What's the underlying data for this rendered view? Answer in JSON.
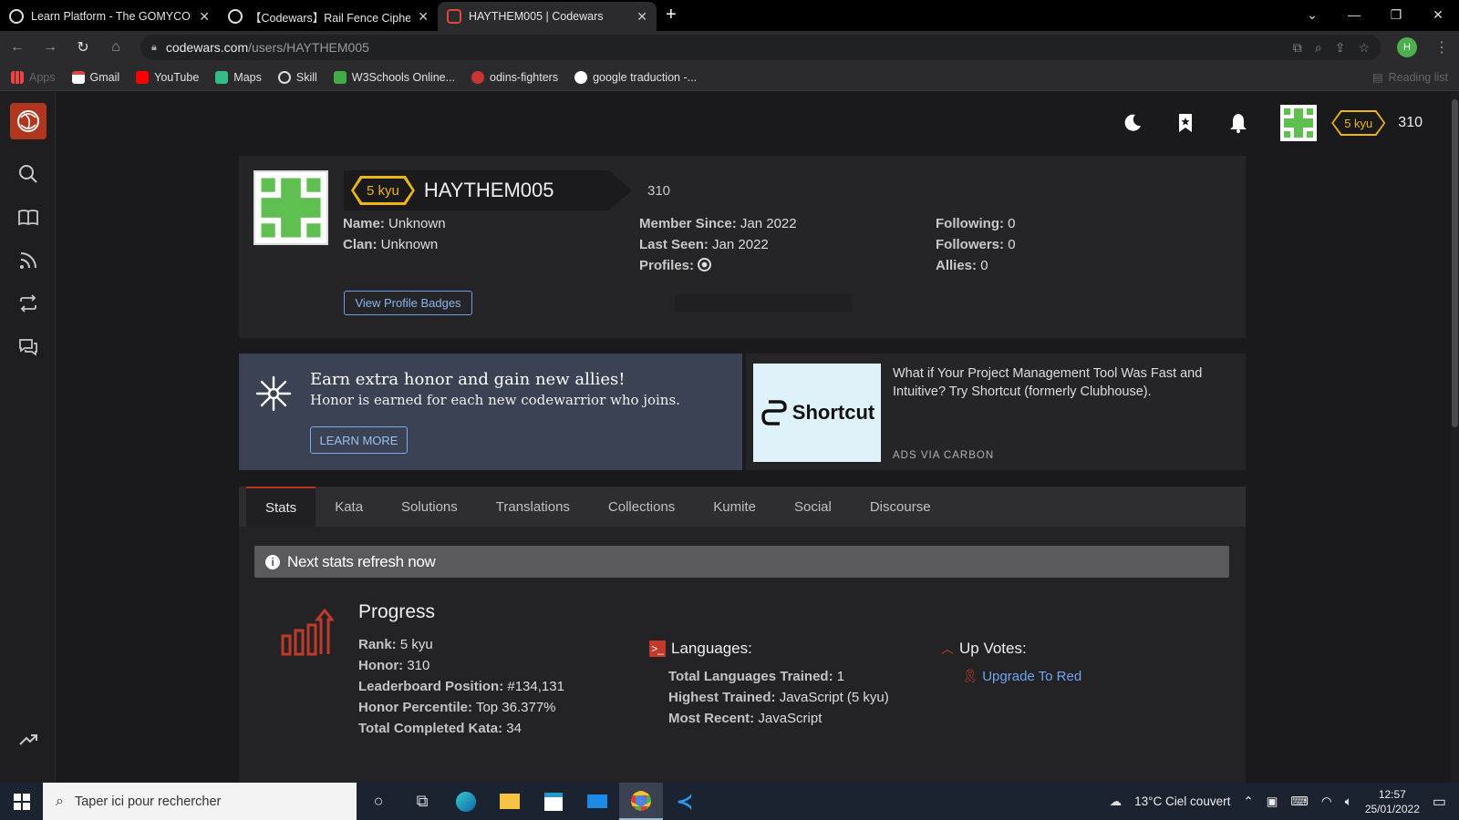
{
  "browser": {
    "tabs": [
      {
        "title": "Learn Platform - The GOMYCODE",
        "close": "✕",
        "favicon": "globe-icon"
      },
      {
        "title": "【Codewars】Rail Fence Cipher: En",
        "close": "✕",
        "favicon": "globe-icon"
      },
      {
        "title": "HAYTHEM005 | Codewars",
        "close": "✕",
        "favicon": "codewars-icon"
      }
    ],
    "new_tab": "+",
    "url_domain": "codewars.com",
    "url_path": "/users/HAYTHEM005",
    "profile_initial": "H",
    "bookmarks": [
      {
        "label": "Apps"
      },
      {
        "label": "Gmail"
      },
      {
        "label": "YouTube"
      },
      {
        "label": "Maps"
      },
      {
        "label": "Skill"
      },
      {
        "label": "W3Schools Online..."
      },
      {
        "label": "odins-fighters"
      },
      {
        "label": "google traduction -..."
      }
    ],
    "reading_list": "Reading list"
  },
  "header": {
    "rank": "5 kyu",
    "honor": "310"
  },
  "profile": {
    "rank": "5 kyu",
    "username": "HAYTHEM005",
    "honor": "310",
    "name_label": "Name:",
    "name_value": "Unknown",
    "clan_label": "Clan:",
    "clan_value": "Unknown",
    "member_since_label": "Member Since:",
    "member_since_value": "Jan 2022",
    "last_seen_label": "Last Seen:",
    "last_seen_value": "Jan 2022",
    "profiles_label": "Profiles:",
    "following_label": "Following:",
    "following_value": "0",
    "followers_label": "Followers:",
    "followers_value": "0",
    "allies_label": "Allies:",
    "allies_value": "0",
    "badges_button": "View Profile Badges"
  },
  "promo": {
    "title": "Earn extra honor and gain new allies!",
    "text": "Honor is earned for each new codewarrior who joins.",
    "button": "LEARN MORE"
  },
  "ad": {
    "brand": "Shortcut",
    "text": "What if Your Project Management Tool Was Fast and Intuitive? Try Shortcut (formerly Clubhouse).",
    "via": "ADS VIA CARBON"
  },
  "tabs": [
    "Stats",
    "Kata",
    "Solutions",
    "Translations",
    "Collections",
    "Kumite",
    "Social",
    "Discourse"
  ],
  "stats": {
    "refresh_notice": "Next stats refresh now",
    "progress_title": "Progress",
    "rank_label": "Rank:",
    "rank_value": "5 kyu",
    "honor_label": "Honor:",
    "honor_value": "310",
    "leaderboard_label": "Leaderboard Position:",
    "leaderboard_value": "#134,131",
    "percentile_label": "Honor Percentile:",
    "percentile_value": "Top 36.377%",
    "completed_label": "Total Completed Kata:",
    "completed_value": "34",
    "languages_title": "Languages:",
    "trained_label": "Total Languages Trained:",
    "trained_value": "1",
    "highest_label": "Highest Trained:",
    "highest_value": "JavaScript (5 kyu)",
    "recent_label": "Most Recent:",
    "recent_value": "JavaScript",
    "upvotes_title": "Up Votes:",
    "upgrade_link": "Upgrade To Red"
  },
  "taskbar": {
    "search_placeholder": "Taper ici pour rechercher",
    "weather": "13°C  Ciel couvert",
    "time": "12:57",
    "date": "25/01/2022"
  },
  "colors": {
    "accent": "#b1361e",
    "rank_yellow": "#ecb613",
    "link_blue": "#6ea6f0",
    "promo_bg": "#3a4253"
  }
}
